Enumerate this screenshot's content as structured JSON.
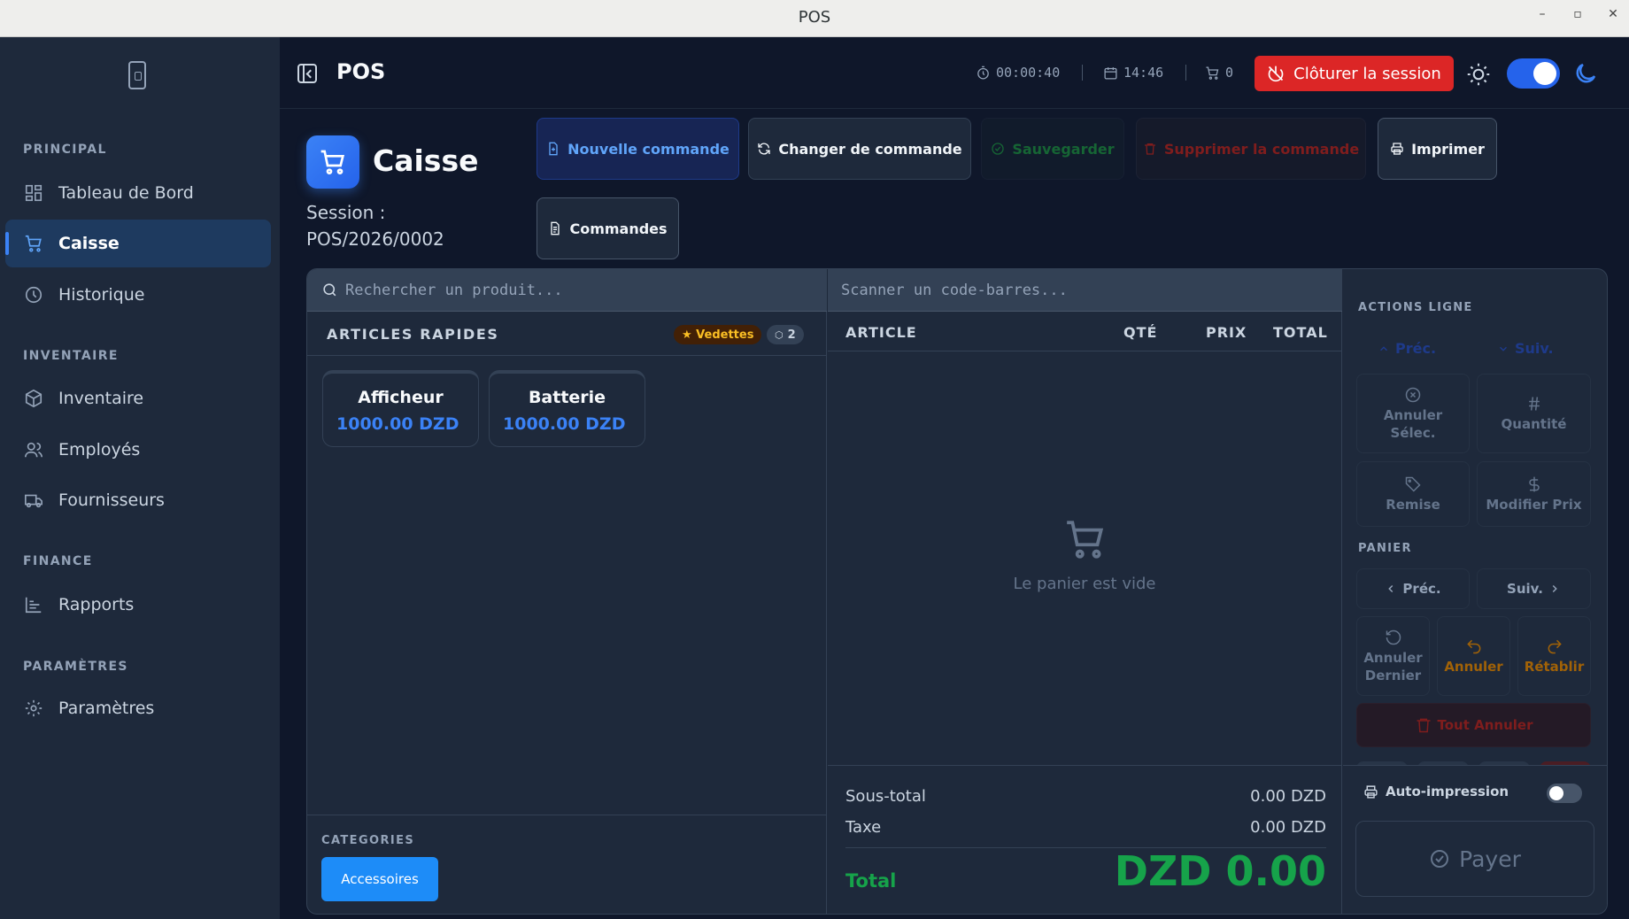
{
  "window": {
    "title": "POS",
    "minimize": "–",
    "maximize": "▫",
    "close": "✕"
  },
  "sidebar": {
    "sections": [
      {
        "title": "PRINCIPAL"
      },
      {
        "title": "INVENTAIRE"
      },
      {
        "title": "FINANCE"
      },
      {
        "title": "PARAMÈTRES"
      }
    ],
    "items": [
      {
        "label": "Tableau de Bord",
        "icon": "dashboard-icon"
      },
      {
        "label": "Caisse",
        "icon": "cart-icon",
        "active": true
      },
      {
        "label": "Historique",
        "icon": "history-icon"
      },
      {
        "label": "Inventaire",
        "icon": "box-icon"
      },
      {
        "label": "Employés",
        "icon": "users-icon"
      },
      {
        "label": "Fournisseurs",
        "icon": "truck-icon"
      },
      {
        "label": "Rapports",
        "icon": "chart-icon"
      },
      {
        "label": "Paramètres",
        "icon": "gear-icon"
      }
    ]
  },
  "topbar": {
    "title": "POS",
    "timer": "00:00:40",
    "clock": "14:46",
    "cart_count": "0",
    "close_session": "Clôturer la session",
    "dark_mode": true
  },
  "header": {
    "title": "Caisse",
    "session_label": "Session :",
    "session_id": "POS/2026/0002",
    "buttons": {
      "new_order": "Nouvelle commande",
      "change_order": "Changer de commande",
      "save": "Sauvegarder",
      "delete_order": "Supprimer la commande",
      "print": "Imprimer",
      "orders": "Commandes"
    }
  },
  "products": {
    "search_placeholder": "Rechercher un produit...",
    "quick_title": "ARTICLES RAPIDES",
    "featured_badge": "★ Vedettes",
    "count_badge": "2",
    "items": [
      {
        "name": "Afficheur",
        "price": "1000.00 DZD"
      },
      {
        "name": "Batterie",
        "price": "1000.00 DZD"
      }
    ],
    "categories_title": "CATEGORIES",
    "categories": [
      "Accessoires"
    ]
  },
  "cart": {
    "scan_placeholder": "Scanner un code-barres...",
    "columns": {
      "article": "ARTICLE",
      "qty": "QTÉ",
      "price": "PRIX",
      "total": "TOTAL"
    },
    "empty_text": "Le panier est vide",
    "subtotal_label": "Sous-total",
    "subtotal": "0.00 DZD",
    "tax_label": "Taxe",
    "tax": "0.00 DZD",
    "total_label": "Total",
    "total": "DZD 0.00"
  },
  "actions": {
    "line_title": "ACTIONS LIGNE",
    "prev": "Préc.",
    "next": "Suiv.",
    "cancel_sel": "Annuler Sélec.",
    "quantity": "Quantité",
    "discount": "Remise",
    "edit_price": "Modifier Prix",
    "cart_title": "PANIER",
    "cart_prev": "Préc.",
    "cart_next": "Suiv.",
    "cancel_last": "Annuler Dernier",
    "undo": "Annuler",
    "redo": "Rétablir",
    "cancel_all": "Tout Annuler",
    "auto_print": "Auto-impression",
    "auto_print_on": false,
    "pay": "Payer"
  }
}
